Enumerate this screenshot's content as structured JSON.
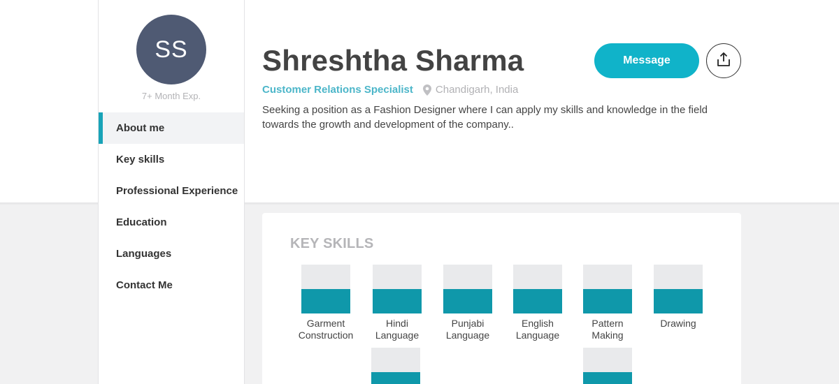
{
  "profile": {
    "initials": "SS",
    "experience": "7+ Month Exp.",
    "name": "Shreshtha Sharma",
    "job_title": "Customer Relations Specialist",
    "location": "Chandigarh, India",
    "summary": "Seeking a position as a Fashion Designer where I can apply my skills and knowledge in the field towards the growth and development of the company.."
  },
  "actions": {
    "message_label": "Message",
    "share_icon": "share-upload-icon"
  },
  "nav": {
    "items": [
      {
        "label": "About me",
        "active": true
      },
      {
        "label": "Key skills",
        "active": false
      },
      {
        "label": "Professional Experience",
        "active": false
      },
      {
        "label": "Education",
        "active": false
      },
      {
        "label": "Languages",
        "active": false
      },
      {
        "label": "Contact Me",
        "active": false
      }
    ]
  },
  "key_skills": {
    "title": "KEY SKILLS",
    "items": [
      {
        "label": "Garment Construction",
        "level": 0.5
      },
      {
        "label": "Hindi Language",
        "level": 0.5
      },
      {
        "label": "Punjabi Language",
        "level": 0.5
      },
      {
        "label": "English Language",
        "level": 0.5
      },
      {
        "label": "Pattern Making",
        "level": 0.5
      },
      {
        "label": "Drawing",
        "level": 0.5
      },
      {
        "label": "",
        "level": 0.5
      },
      {
        "label": "",
        "level": 0.5
      }
    ]
  },
  "colors": {
    "accent": "#10b3c9",
    "skill_fill": "#0f98aa",
    "avatar_bg": "#4f5a73",
    "job_title": "#4cb6c9"
  }
}
